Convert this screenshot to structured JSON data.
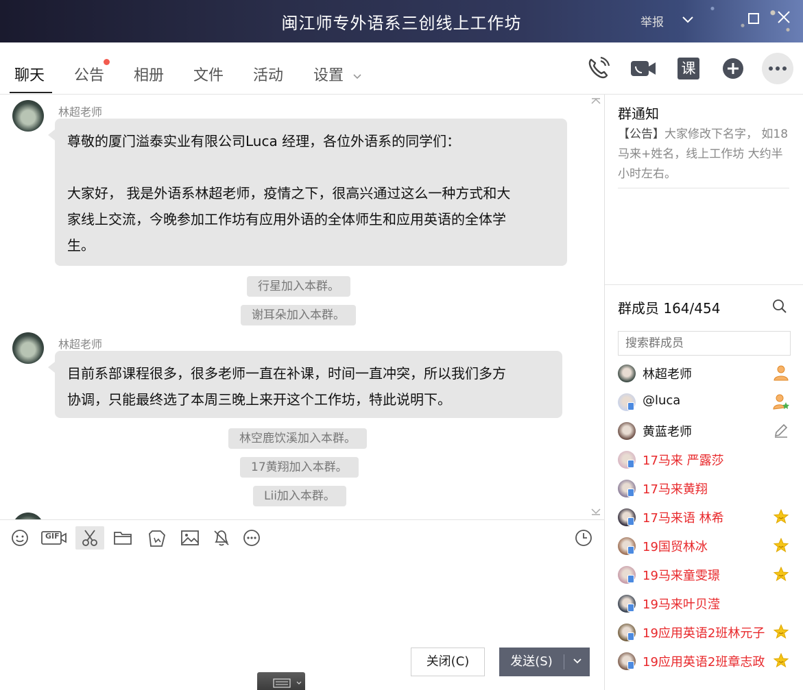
{
  "window": {
    "title": "闽江师专外语系三创线上工作坊",
    "report_label": "举报"
  },
  "tabs": [
    {
      "label": "聊天",
      "active": true
    },
    {
      "label": "公告",
      "has_dot": true
    },
    {
      "label": "相册"
    },
    {
      "label": "文件"
    },
    {
      "label": "活动"
    },
    {
      "label": "设置"
    }
  ],
  "toolbar_icons": [
    "phone-call-icon",
    "video-call-icon",
    "lesson-icon",
    "add-app-icon",
    "more-icon"
  ],
  "lesson_icon_text": "课",
  "chat": {
    "messages": [
      {
        "type": "msg",
        "sender": "林超老师",
        "lines": [
          "尊敬的厦门溢泰实业有限公司Luca 经理，各位外语系的同学们：",
          "",
          "大家好， 我是外语系林超老师，疫情之下，很高兴通过这么一种方式和大",
          "家线上交流，今晚参加工作坊有应用外语的全体师生和应用英语的全体学",
          "生。"
        ]
      },
      {
        "type": "sys",
        "text": "行星加入本群。"
      },
      {
        "type": "sys",
        "text": "谢耳朵加入本群。"
      },
      {
        "type": "msg",
        "sender": "林超老师",
        "lines": [
          "目前系部课程很多，很多老师一直在补课，时间一直冲突，所以我们多方",
          "协调，只能最终选了本周三晚上来开这个工作坊，特此说明下。"
        ]
      },
      {
        "type": "sys",
        "text": "林空鹿饮溪加入本群。"
      },
      {
        "type": "sys",
        "text": "17黄翔加入本群。"
      },
      {
        "type": "sys",
        "text": "Lii加入本群。"
      }
    ]
  },
  "input_tools": [
    "emoji-icon",
    "gif-icon",
    "screenshot-icon",
    "folder-icon",
    "image-edit-icon",
    "image-icon",
    "bell-off-icon",
    "more-dots-icon"
  ],
  "gif_label": "GIF",
  "buttons": {
    "close": "关闭(C)",
    "send": "发送(S)"
  },
  "right_panel": {
    "notice_title": "群通知",
    "notice_tag": "【公告】",
    "notice_text": "大家修改下名字， 如18马来+姓名，线上工作坊 大约半小时左右。",
    "members_title": "群成员 164/454",
    "search_placeholder": "搜索群成员",
    "members": [
      {
        "name": "林超老师",
        "red": false,
        "badge": "owner-icon"
      },
      {
        "name": "@luca",
        "red": false,
        "badge": "admin-icon",
        "phone": true
      },
      {
        "name": "黄蓝老师",
        "red": false,
        "badge": "edit-icon"
      },
      {
        "name": "17马来 严露莎",
        "red": true,
        "badge": "",
        "phone": true
      },
      {
        "name": "17马来黄翔",
        "red": true,
        "badge": "",
        "phone": true
      },
      {
        "name": "17马来语 林希",
        "red": true,
        "badge": "star-icon",
        "phone": true
      },
      {
        "name": "19国贸林冰",
        "red": true,
        "badge": "star-icon",
        "phone": true
      },
      {
        "name": "19马来童雯璟",
        "red": true,
        "badge": "star-icon",
        "phone": true
      },
      {
        "name": "19马来叶贝滢",
        "red": true,
        "badge": "",
        "phone": true
      },
      {
        "name": "19应用英语2班林元子",
        "red": true,
        "badge": "star-icon",
        "phone": true
      },
      {
        "name": "19应用英语2班章志政",
        "red": true,
        "badge": "star-icon",
        "phone": true
      }
    ]
  },
  "colors": {
    "accent_red": "#e8282b",
    "notice_dot": "#f25b4f",
    "star": "#f5c518",
    "bubble": "#e6e6e6",
    "send_button": "#5c6170"
  }
}
